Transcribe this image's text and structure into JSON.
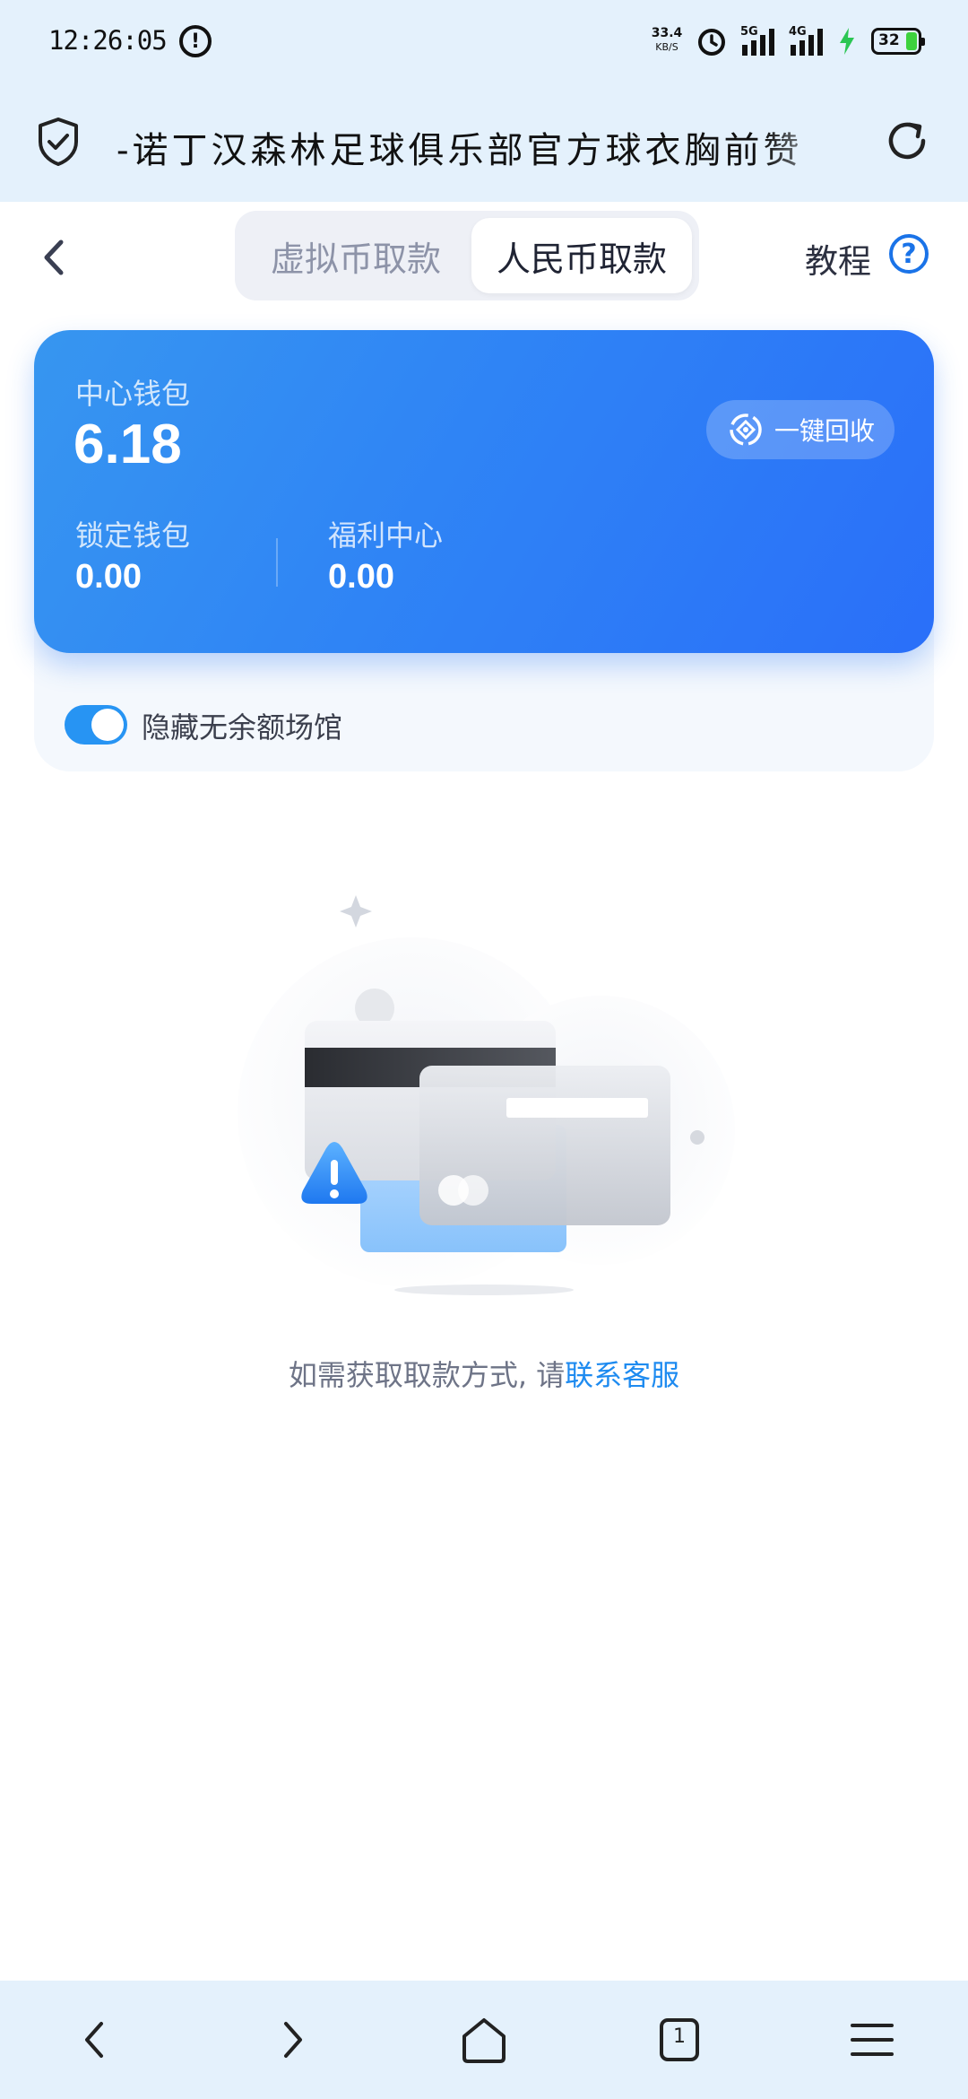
{
  "status_bar": {
    "time": "12:26:05",
    "net_speed_value": "33.4",
    "net_speed_unit": "KB/S",
    "signal1_label": "5G",
    "signal2_label": "4G",
    "battery": "32",
    "battery_color": "#3dd23d"
  },
  "browser": {
    "page_title": "-诺丁汉森林足球俱乐部官方球衣胸前赞"
  },
  "header": {
    "tabs": [
      {
        "label": "虚拟币取款",
        "active": false
      },
      {
        "label": "人民币取款",
        "active": true
      }
    ],
    "tutorial_label": "教程",
    "help_glyph": "?"
  },
  "wallet": {
    "center_label": "中心钱包",
    "center_value": "6.18",
    "recycle_label": "一键回收",
    "locked_label": "锁定钱包",
    "locked_value": "0.00",
    "welfare_label": "福利中心",
    "welfare_value": "0.00",
    "hide_toggle_label": "隐藏无余额场馆",
    "hide_toggle_on": true,
    "accent_color": "#2f84f5"
  },
  "empty_state": {
    "hint_prefix": "如需获取取款方式, 请",
    "hint_link": "联系客服",
    "link_color": "#1e8bf0"
  },
  "icons": {
    "shield": "shield-check-icon",
    "reload": "reload-icon",
    "back": "chevron-left-icon",
    "help": "question-circle-icon",
    "recycle": "recycle-icon",
    "nav": [
      "back-arrow-icon",
      "forward-arrow-icon",
      "home-icon",
      "tabs-icon",
      "menu-icon"
    ]
  },
  "bottom_nav": {
    "tabs_count": "1"
  }
}
